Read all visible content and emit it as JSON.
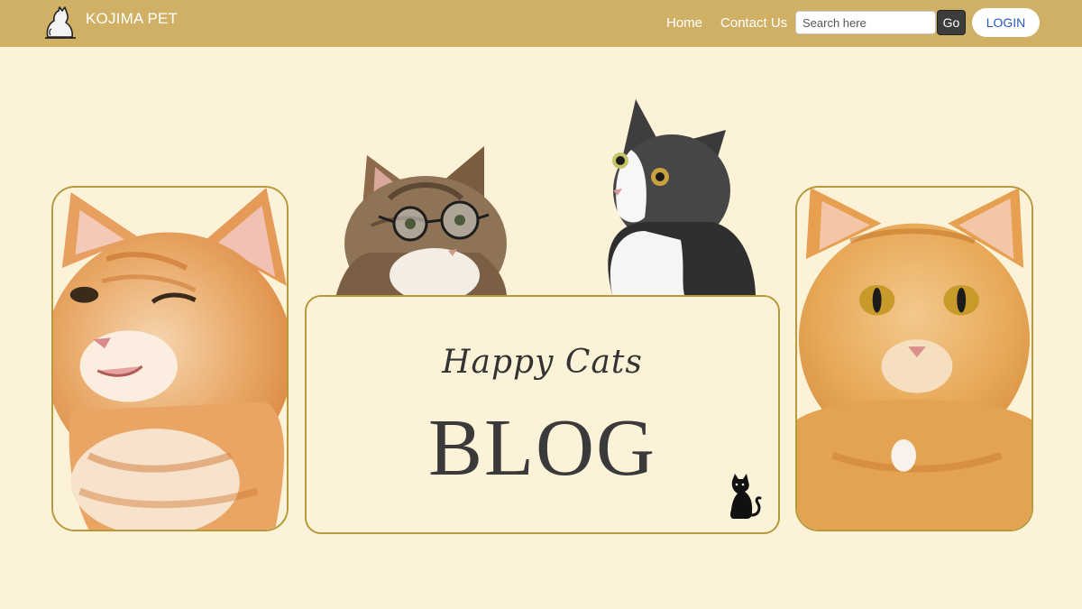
{
  "navbar": {
    "brand": {
      "name": "KOJIMA PET",
      "logo_icon": "cat-logo-icon"
    },
    "links": [
      {
        "label": "Home"
      },
      {
        "label": "Contact Us"
      }
    ],
    "search": {
      "placeholder": "Search here",
      "value": "",
      "button_label": "Go"
    },
    "login_label": "LOGIN"
  },
  "hero": {
    "blog_card": {
      "subtitle": "Happy Cats",
      "title": "BLOG",
      "icon": "black-cat-icon"
    },
    "photos": [
      {
        "name": "winking-orange-cat-photo"
      },
      {
        "name": "cat-with-glasses-photo"
      },
      {
        "name": "black-white-cat-photo"
      },
      {
        "name": "orange-cat-portrait-photo"
      }
    ]
  },
  "colors": {
    "navbar_bg": "#d0b065",
    "page_bg": "#fcf2d8",
    "card_border": "#b59a3c",
    "login_text": "#2a56c6",
    "go_button_bg": "#3c3c3c"
  }
}
